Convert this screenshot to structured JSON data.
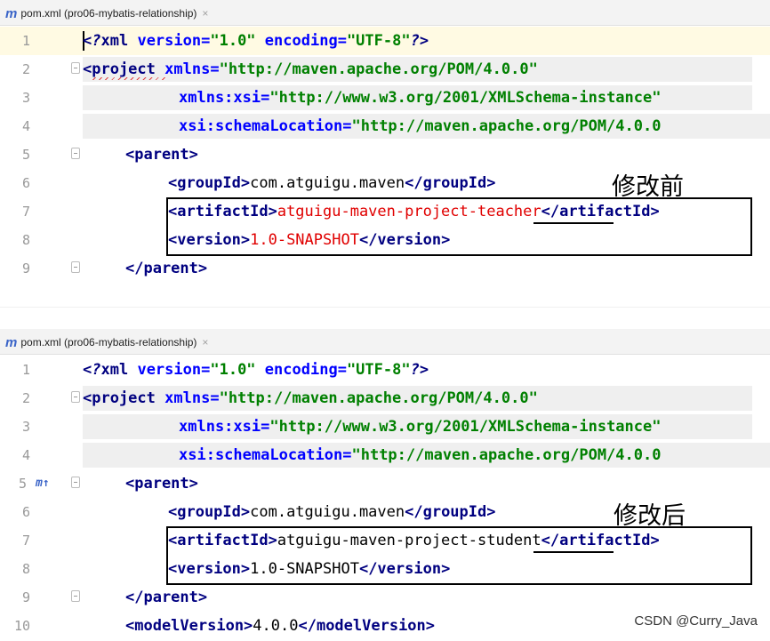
{
  "top": {
    "tab_icon": "m",
    "tab_title": "pom.xml (pro06-mybatis-relationship)",
    "tab_close": "×",
    "label": "修改前",
    "lines": [
      {
        "n": "1"
      },
      {
        "n": "2"
      },
      {
        "n": "3"
      },
      {
        "n": "4"
      },
      {
        "n": "5"
      },
      {
        "n": "6"
      },
      {
        "n": "7"
      },
      {
        "n": "8"
      },
      {
        "n": "9"
      }
    ],
    "artifact_value": "atguigu-maven-project-teacher",
    "version_value": "1.0-SNAPSHOT",
    "group_value": "com.atguigu.maven"
  },
  "bottom": {
    "tab_icon": "m",
    "tab_title": "pom.xml (pro06-mybatis-relationship)",
    "tab_close": "×",
    "label": "修改后",
    "lines": [
      {
        "n": "1"
      },
      {
        "n": "2"
      },
      {
        "n": "3"
      },
      {
        "n": "4"
      },
      {
        "n": "5"
      },
      {
        "n": "6"
      },
      {
        "n": "7"
      },
      {
        "n": "8"
      },
      {
        "n": "9"
      },
      {
        "n": "10"
      }
    ],
    "gutter_marker": "m↑",
    "artifact_value": "atguigu-maven-project-student",
    "version_value": "1.0-SNAPSHOT",
    "group_value": "com.atguigu.maven",
    "model_version": "4.0.0"
  },
  "xml": {
    "decl_open": "<?",
    "decl_name": "xml",
    "version_attr": "version",
    "version_val": "\"1.0\"",
    "encoding_attr": "encoding",
    "encoding_val": "\"UTF-8\"",
    "decl_close": "?>",
    "project_open": "<project",
    "xmlns_attr": "xmlns",
    "xmlns_val": "\"http://maven.apache.org/POM/4.0.0\"",
    "xsi_attr": "xmlns:xsi",
    "xsi_val": "\"http://www.w3.org/2001/XMLSchema-instance\"",
    "schema_attr": "xsi:schemaLocation",
    "schema_val": "\"http://maven.apache.org/POM/4.0.0",
    "parent_open": "<parent>",
    "parent_close": "</parent>",
    "group_open": "<groupId>",
    "group_close": "</groupId>",
    "artifact_open": "<artifactId>",
    "artifact_close": "</artifactId>",
    "version_open": "<version>",
    "version_close": "</version>",
    "model_open": "<modelVersion>",
    "model_close": "</modelVersion>",
    "eq": "="
  },
  "watermark": "CSDN @Curry_Java"
}
